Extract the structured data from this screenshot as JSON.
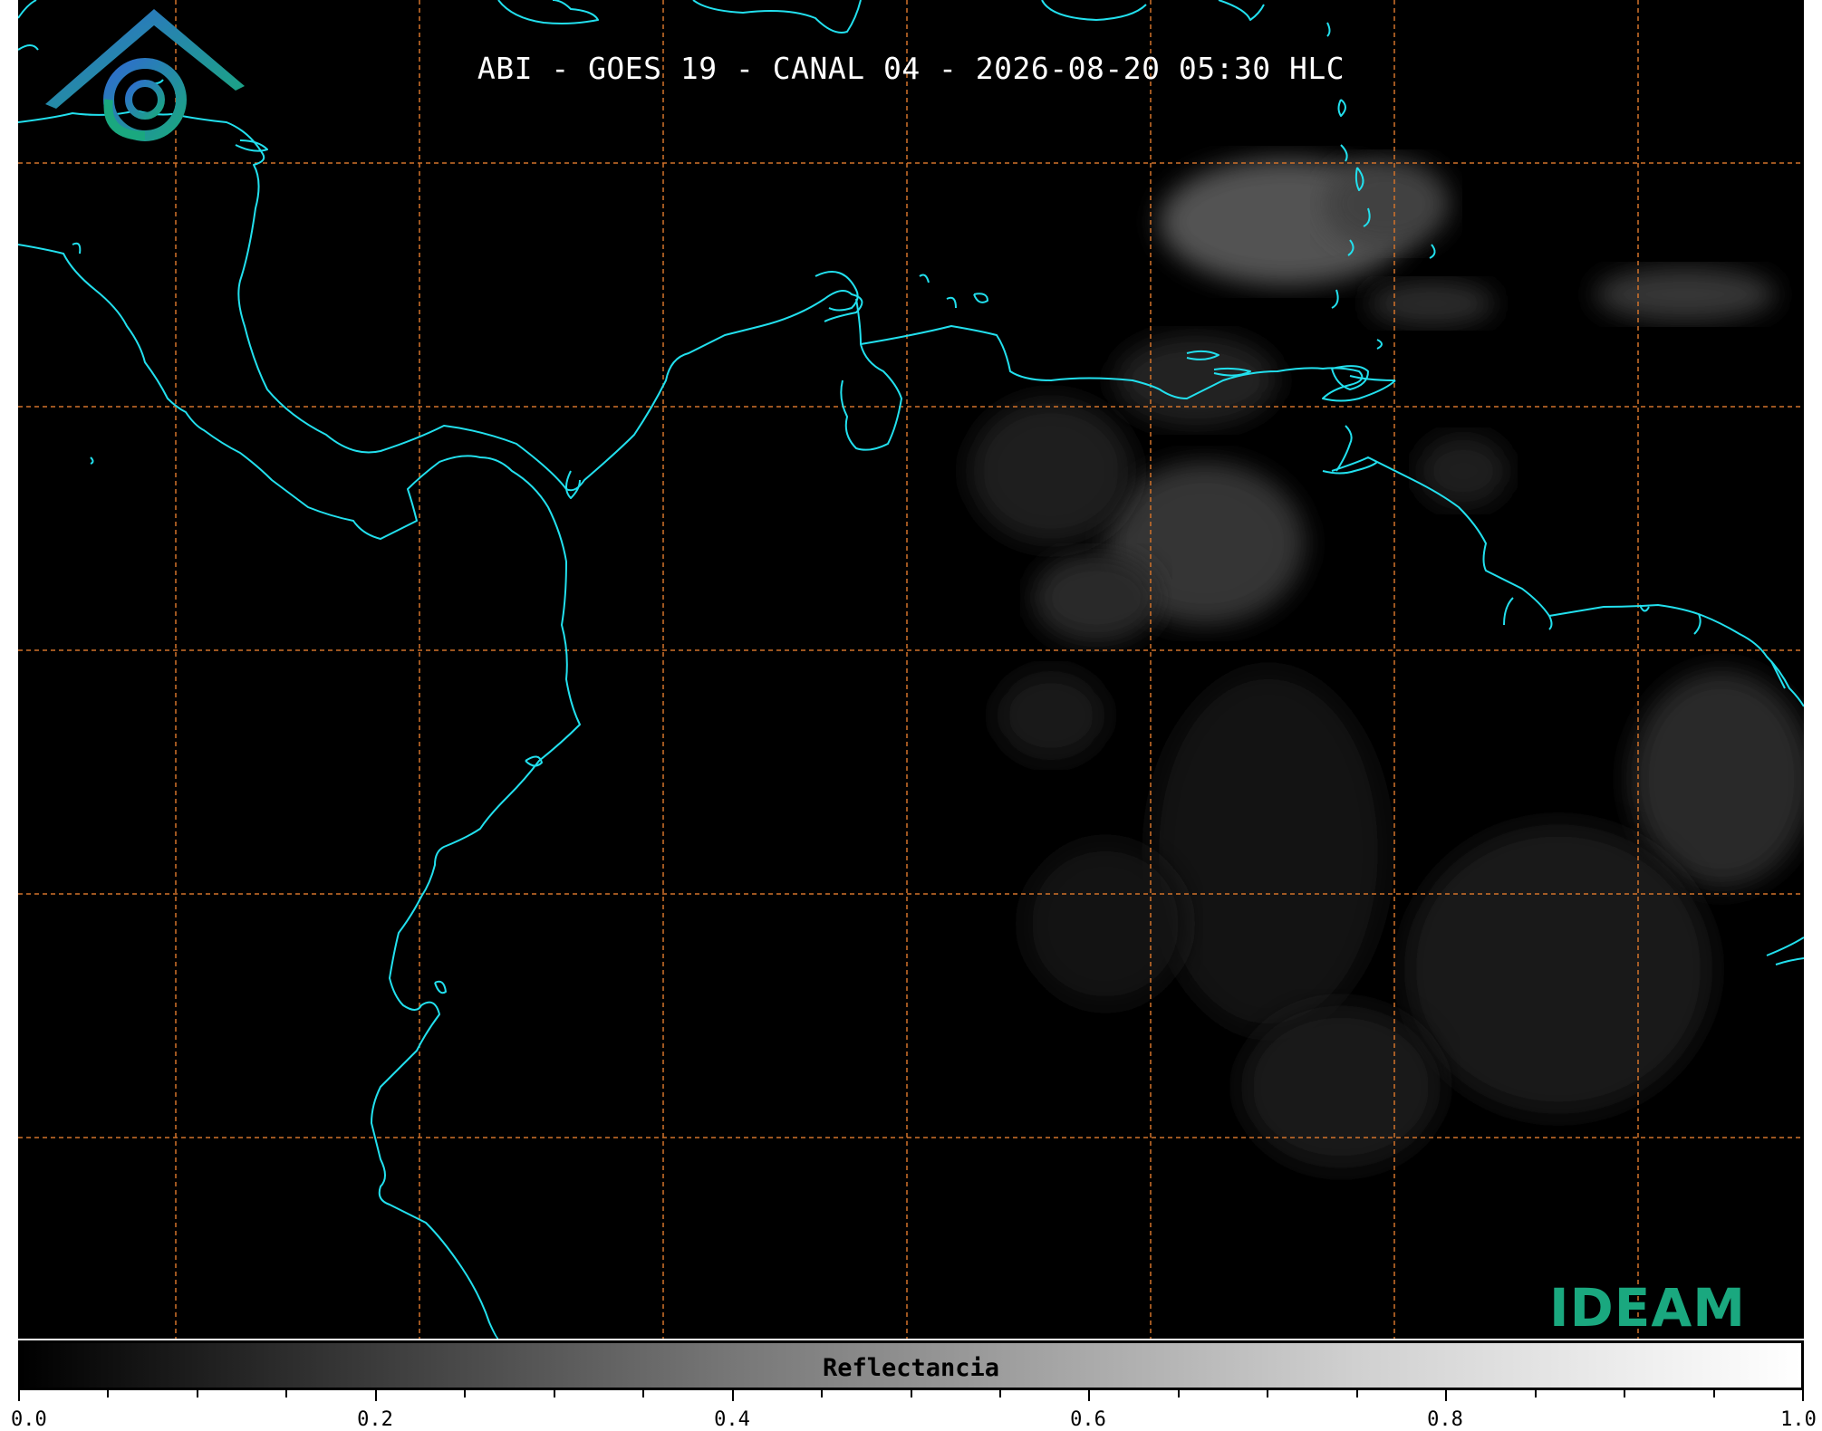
{
  "map": {
    "title": "ABI - GOES 19 - CANAL 04 - 2026-08-20 05:30 HLC",
    "background_color": "#000000",
    "coastline_color": "#22e0ee",
    "gridline_color": "#d2722a",
    "logo": {
      "text": "IDEAM",
      "icon": "ideam-logo-icon",
      "color": "#1aa87f"
    }
  },
  "colorbar": {
    "label": "Reflectancia",
    "ticks": [
      "0.0",
      "0.2",
      "0.4",
      "0.6",
      "0.8",
      "1.0"
    ],
    "min": 0.0,
    "max": 1.0,
    "colors": [
      "#000000",
      "#ffffff"
    ]
  }
}
